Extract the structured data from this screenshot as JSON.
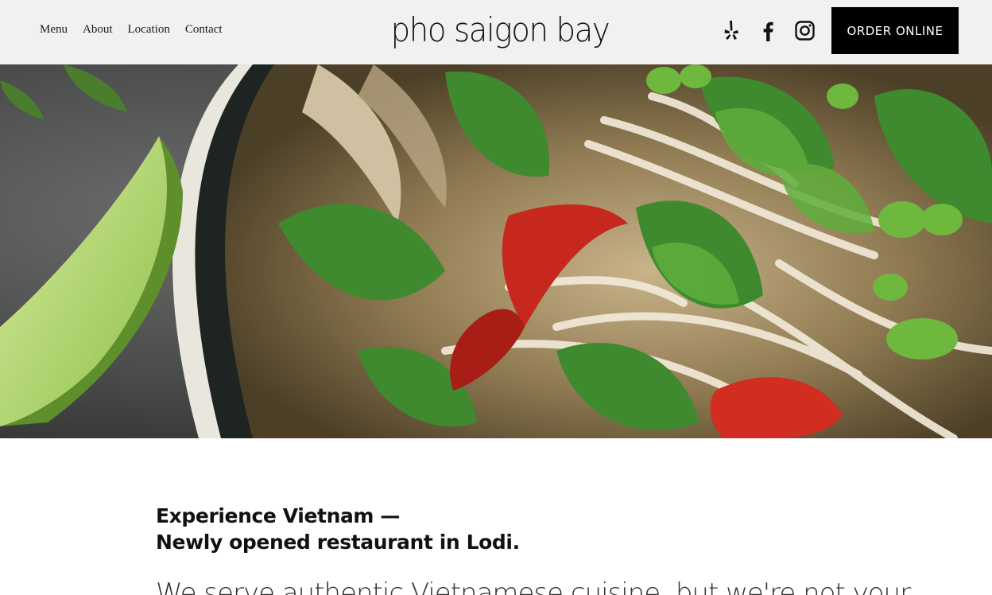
{
  "nav": {
    "items": [
      {
        "label": "Menu"
      },
      {
        "label": "About"
      },
      {
        "label": "Location"
      },
      {
        "label": "Contact"
      }
    ]
  },
  "brand": {
    "logo_text": "pho saigon bay"
  },
  "social": {
    "icons": [
      "yelp-icon",
      "facebook-icon",
      "instagram-icon"
    ]
  },
  "cta": {
    "order_label": "ORDER ONLINE"
  },
  "hero": {
    "image_desc": "pho-bowl-photo"
  },
  "content": {
    "headline_line1": "Experience Vietnam —",
    "headline_line2": "Newly opened restaurant in Lodi.",
    "intro": "We serve authentic Vietnamese cuisine, but we're not your"
  },
  "colors": {
    "header_bg": "#f1f1f1",
    "button_bg": "#000000",
    "button_text": "#ffffff",
    "text": "#111111"
  }
}
